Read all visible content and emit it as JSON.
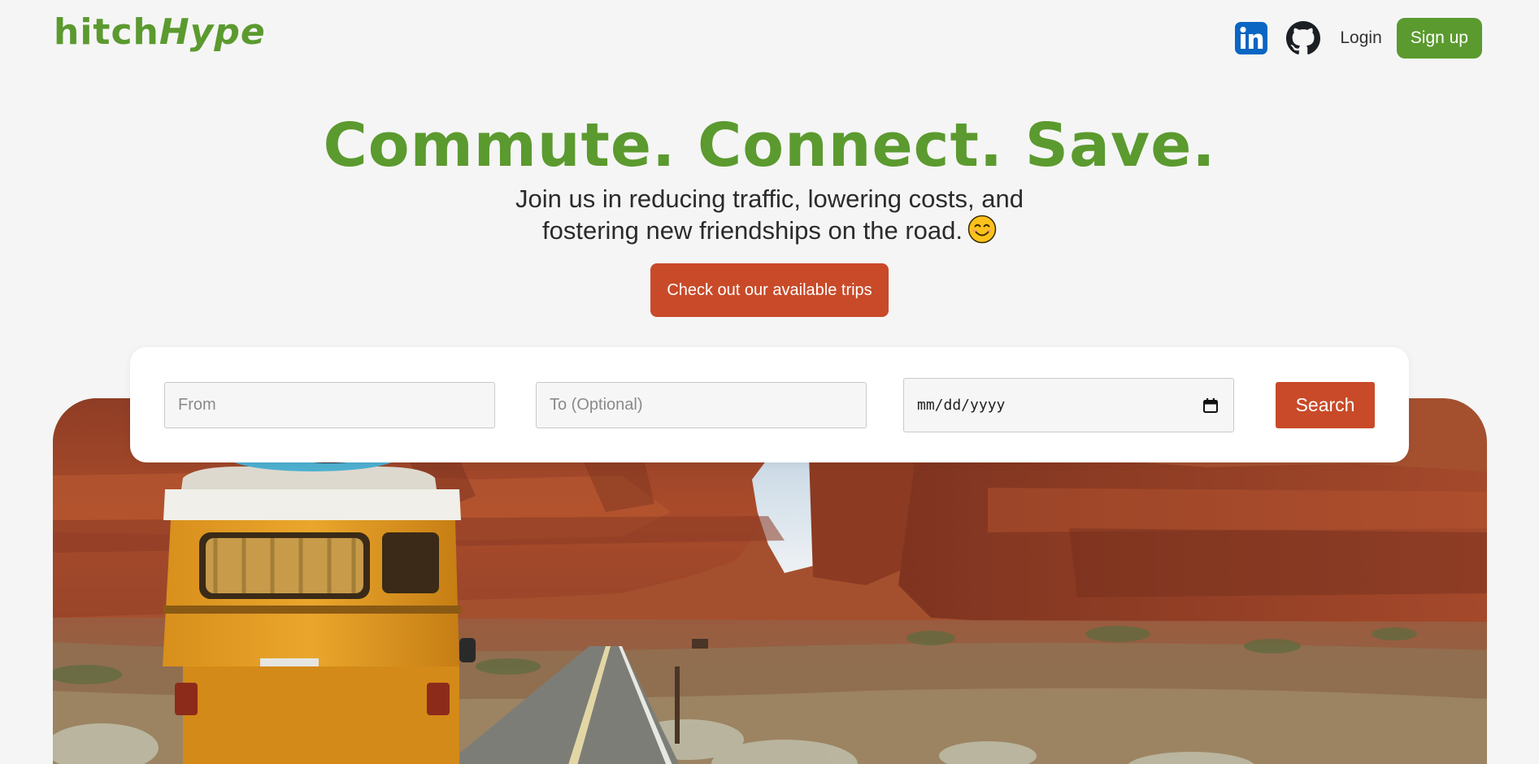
{
  "brand": {
    "name_part1": "hitch",
    "name_part2": "Hype"
  },
  "nav": {
    "linkedin_icon": "linkedin-icon",
    "github_icon": "github-icon",
    "login_label": "Login",
    "signup_label": "Sign up"
  },
  "hero": {
    "title": "Commute. Connect. Save.",
    "subtitle_line1": "Join us in reducing traffic, lowering costs, and",
    "subtitle_line2": "fostering new friendships on the road.",
    "emoji": "smiling-face-emoji",
    "cta_label": "Check out our available trips"
  },
  "search": {
    "from_placeholder": "From",
    "to_placeholder": "To (Optional)",
    "date_placeholder": "mm/dd/yyyy",
    "button_label": "Search"
  },
  "colors": {
    "brand_green": "#5b9a2f",
    "accent_orange": "#c84a29",
    "background": "#f5f5f5",
    "linkedin_blue": "#0a66c2"
  }
}
